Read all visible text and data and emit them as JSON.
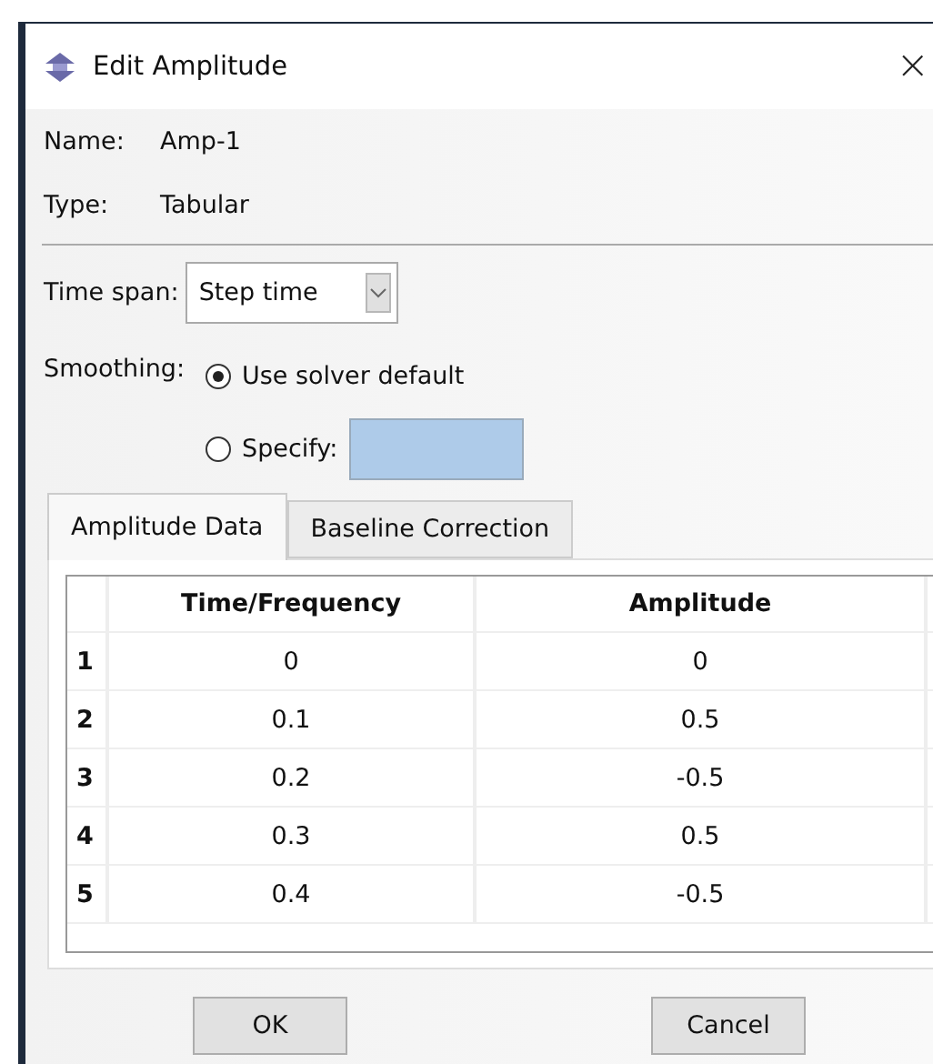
{
  "window": {
    "title": "Edit Amplitude",
    "close": "×"
  },
  "name": {
    "label": "Name:",
    "value": "Amp-1"
  },
  "type": {
    "label": "Type:",
    "value": "Tabular"
  },
  "time_span": {
    "label": "Time span:",
    "value": "Step time"
  },
  "smoothing": {
    "label": "Smoothing:",
    "options": [
      {
        "label": "Use solver default",
        "selected": true,
        "kind": "radio"
      },
      {
        "label": "Specify:",
        "selected": false,
        "kind": "radio_field"
      }
    ]
  },
  "tabs": [
    {
      "label": "Amplitude Data",
      "selected": true
    },
    {
      "label": "Baseline Correction",
      "selected": false
    }
  ],
  "table": {
    "columns": [
      "Time/Frequency",
      "Amplitude"
    ],
    "rows": [
      {
        "index": "1",
        "cells": [
          "0",
          "0"
        ]
      },
      {
        "index": "2",
        "cells": [
          "0.1",
          "0.5"
        ]
      },
      {
        "index": "3",
        "cells": [
          "0.2",
          "-0.5"
        ]
      },
      {
        "index": "4",
        "cells": [
          "0.3",
          "0.5"
        ]
      },
      {
        "index": "5",
        "cells": [
          "0.4",
          "-0.5"
        ]
      }
    ]
  },
  "buttons": [
    "OK",
    "Cancel"
  ]
}
